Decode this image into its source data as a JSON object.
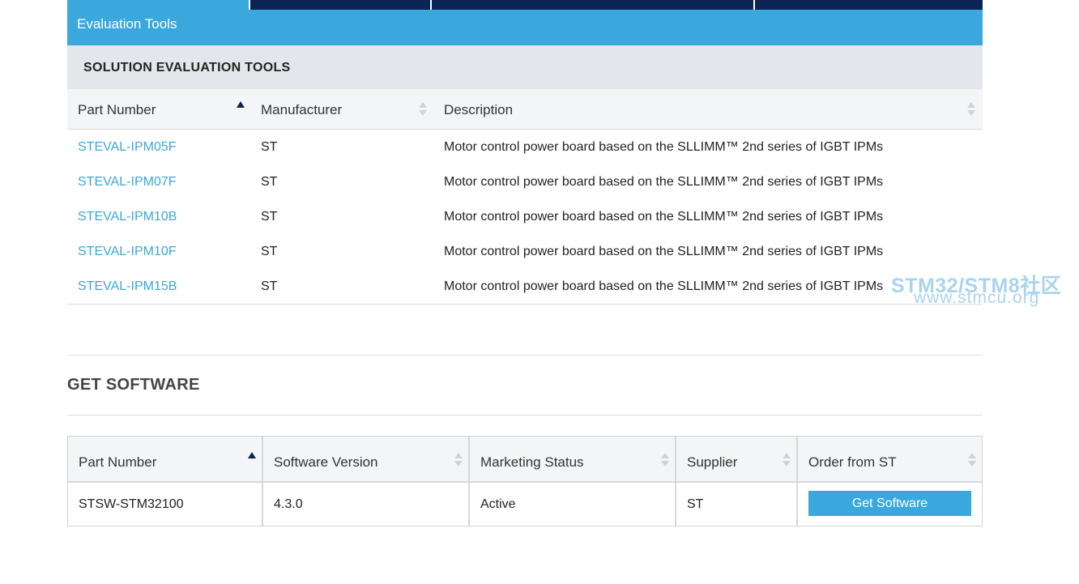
{
  "tabs": {
    "active_label": "Evaluation Tools"
  },
  "solution_eval": {
    "title": "SOLUTION EVALUATION TOOLS",
    "columns": [
      "Part Number",
      "Manufacturer",
      "Description"
    ],
    "rows": [
      {
        "part": "STEVAL-IPM05F",
        "manufacturer": "ST",
        "description": "Motor control power board based on the SLLIMM™ 2nd series of IGBT IPMs"
      },
      {
        "part": "STEVAL-IPM07F",
        "manufacturer": "ST",
        "description": "Motor control power board based on the SLLIMM™ 2nd series of IGBT IPMs"
      },
      {
        "part": "STEVAL-IPM10B",
        "manufacturer": "ST",
        "description": "Motor control power board based on the SLLIMM™ 2nd series of IGBT IPMs"
      },
      {
        "part": "STEVAL-IPM10F",
        "manufacturer": "ST",
        "description": "Motor control power board based on the SLLIMM™ 2nd series of IGBT IPMs"
      },
      {
        "part": "STEVAL-IPM15B",
        "manufacturer": "ST",
        "description": "Motor control power board based on the SLLIMM™ 2nd series of IGBT IPMs"
      }
    ]
  },
  "get_software": {
    "title": "GET SOFTWARE",
    "columns": [
      "Part Number",
      "Software Version",
      "Marketing Status",
      "Supplier",
      "Order from ST"
    ],
    "row": {
      "part": "STSW-STM32100",
      "version": "4.3.0",
      "status": "Active",
      "supplier": "ST",
      "button_label": "Get Software"
    }
  },
  "watermark": {
    "line1": "STM32/STM8社区",
    "line2": "www.stmcu.org"
  },
  "colors": {
    "accent": "#3aa8dc",
    "navy": "#0b2355",
    "section_bg": "#e3e6ea"
  }
}
